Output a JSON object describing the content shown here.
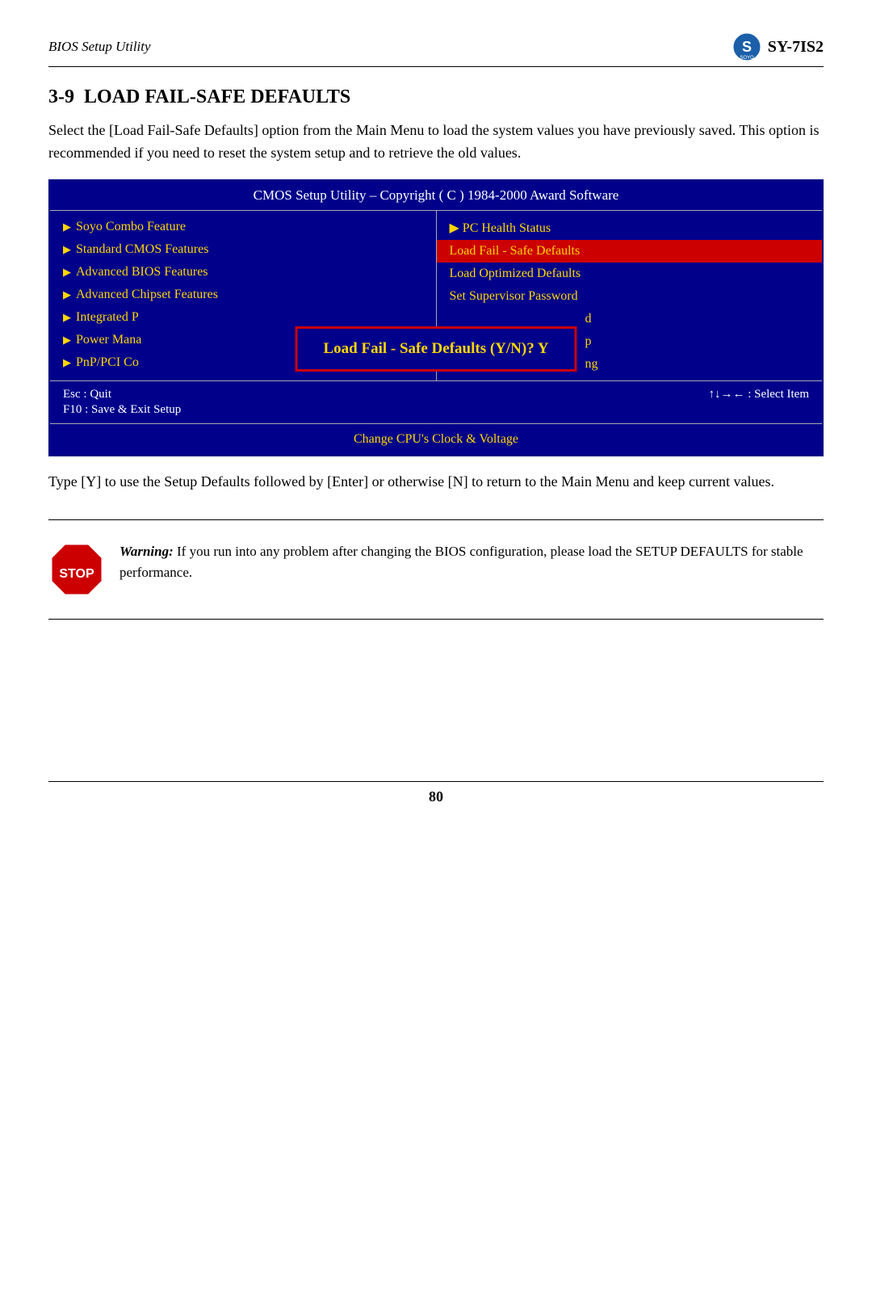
{
  "header": {
    "title": "BIOS Setup Utility",
    "model": "SY-7IS2"
  },
  "section": {
    "number": "3-9",
    "title": "LOAD FAIL-SAFE DEFAULTS"
  },
  "intro_text": "Select the [Load Fail-Safe Defaults] option from the Main Menu to load the system values you have previously saved. This option is recommended if you need to reset the system setup and to retrieve the old values.",
  "bios": {
    "title_bar": "CMOS Setup Utility – Copyright ( C ) 1984-2000 Award Software",
    "left_menu": [
      {
        "label": "Soyo Combo Feature"
      },
      {
        "label": "Standard CMOS Features"
      },
      {
        "label": "Advanced BIOS Features"
      },
      {
        "label": "Advanced Chipset Features"
      },
      {
        "label": "Integrated P..."
      },
      {
        "label": "Power Mana..."
      },
      {
        "label": "PnP/PCI Co..."
      }
    ],
    "right_menu": [
      {
        "label": "PC Health Status",
        "highlighted": false
      },
      {
        "label": "Load Fail - Safe Defaults",
        "highlighted": true
      },
      {
        "label": "Load Optimized Defaults",
        "highlighted": false
      },
      {
        "label": "Set Supervisor Password",
        "highlighted": false
      }
    ],
    "right_partial": [
      {
        "label": "...d"
      },
      {
        "label": "...p"
      },
      {
        "label": "...ng"
      }
    ],
    "dialog": {
      "text": "Load Fail - Safe Defaults (Y/N)? Y"
    },
    "footer": {
      "left_line1": "Esc : Quit",
      "left_line2": "F10 : Save & Exit Setup",
      "right_text": "↑↓→←  :  Select Item"
    },
    "bottom_bar": "Change CPU's Clock & Voltage"
  },
  "after_text": "Type [Y] to use the Setup Defaults followed by [Enter] or otherwise [N] to return to the Main Menu and keep current values.",
  "warning": {
    "bold_label": "Warning:",
    "text": " If you run into any problem after changing the BIOS configuration, please load the SETUP DEFAULTS for stable performance."
  },
  "page_number": "80"
}
